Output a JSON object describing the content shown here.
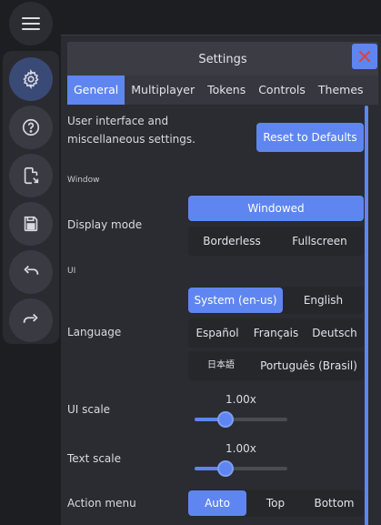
{
  "toolbar": {
    "icons": [
      "menu-icon",
      "gear-icon",
      "help-icon",
      "export-icon",
      "save-icon",
      "undo-icon",
      "redo-icon"
    ]
  },
  "window": {
    "title": "Settings",
    "close_icon": "close-icon"
  },
  "tabs": [
    {
      "label": "General",
      "active": true
    },
    {
      "label": "Multiplayer"
    },
    {
      "label": "Tokens"
    },
    {
      "label": "Controls"
    },
    {
      "label": "Themes"
    }
  ],
  "general": {
    "description": "User interface and miscellaneous settings.",
    "reset_label": "Reset to Defaults",
    "window_section": "Window",
    "display_mode": {
      "label": "Display mode",
      "options": [
        "Windowed",
        "Borderless",
        "Fullscreen"
      ],
      "selected": "Windowed"
    },
    "ui_section": "UI",
    "language": {
      "label": "Language",
      "options": [
        "System (en-us)",
        "English",
        "Español",
        "Français",
        "Deutsch",
        "日本語",
        "Português (Brasil)"
      ],
      "selected": "System (en-us)"
    },
    "ui_scale": {
      "label": "UI scale",
      "value_text": "1.00x",
      "level": 0.33
    },
    "text_scale": {
      "label": "Text scale",
      "value_text": "1.00x",
      "level": 0.33
    },
    "action_menu": {
      "label": "Action menu",
      "options": [
        "Auto",
        "Top",
        "Bottom"
      ],
      "selected": "Auto"
    }
  },
  "colors": {
    "accent": "#5f86f0",
    "close_x": "#e0404a",
    "background": "#1d1e22",
    "panel": "#2b2c31"
  }
}
